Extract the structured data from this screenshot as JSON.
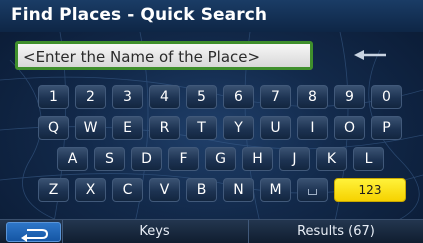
{
  "header": {
    "title": "Find Places - Quick Search"
  },
  "search": {
    "value": "<Enter the Name of the Place>"
  },
  "keyboard": {
    "row1": [
      "1",
      "2",
      "3",
      "4",
      "5",
      "6",
      "7",
      "8",
      "9",
      "0"
    ],
    "row2": [
      "Q",
      "W",
      "E",
      "R",
      "T",
      "Y",
      "U",
      "I",
      "O",
      "P"
    ],
    "row3": [
      "A",
      "S",
      "D",
      "F",
      "G",
      "H",
      "J",
      "K",
      "L"
    ],
    "row4": [
      "Z",
      "X",
      "C",
      "V",
      "B",
      "N",
      "M"
    ],
    "numbers_label": "123"
  },
  "bottom_bar": {
    "keys_label": "Keys",
    "results_label": "Results (67)"
  },
  "icons": {
    "backspace": "backspace-arrow-icon",
    "back": "back-arrow-icon",
    "space": "space-icon"
  },
  "colors": {
    "accent_yellow": "#f6d200",
    "input_border_green": "#3f8f2c",
    "back_button_blue": "#1556a4"
  }
}
